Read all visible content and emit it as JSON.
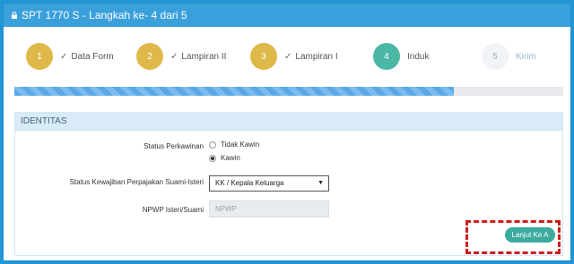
{
  "window": {
    "title": "SPT 1770 S - Langkah ke- 4 dari 5",
    "icon": "lock-icon"
  },
  "steps": [
    {
      "number": "1",
      "label": "Data Form",
      "state": "done"
    },
    {
      "number": "2",
      "label": "Lampiran II",
      "state": "done"
    },
    {
      "number": "3",
      "label": "Lampiran I",
      "state": "done"
    },
    {
      "number": "4",
      "label": "Induk",
      "state": "active"
    },
    {
      "number": "5",
      "label": "Kirim",
      "state": "pending"
    }
  ],
  "progress": {
    "fraction": 0.8
  },
  "colors": {
    "done": "#dfb84a",
    "active": "#4bb7a5",
    "pending": "#f1f3f6",
    "button": "#3cab9c",
    "highlight": "#d01c1c"
  },
  "form": {
    "section_title": "IDENTITAS",
    "status_perkawinan_label": "Status Perkawinan",
    "options": {
      "tidak_kawin": "Tidak Kawin",
      "kawin": "Kawin"
    },
    "selected_status": "Kawin",
    "kewajiban_label": "Status Kewajiban Perpajakan Suami-Isteri",
    "kewajiban_value": "KK / Kepala Keluarga",
    "npwp_label": "NPWP Isteri/Suami",
    "npwp_placeholder": "NPWP"
  },
  "actions": {
    "next_label": "Lanjut Ke A"
  }
}
